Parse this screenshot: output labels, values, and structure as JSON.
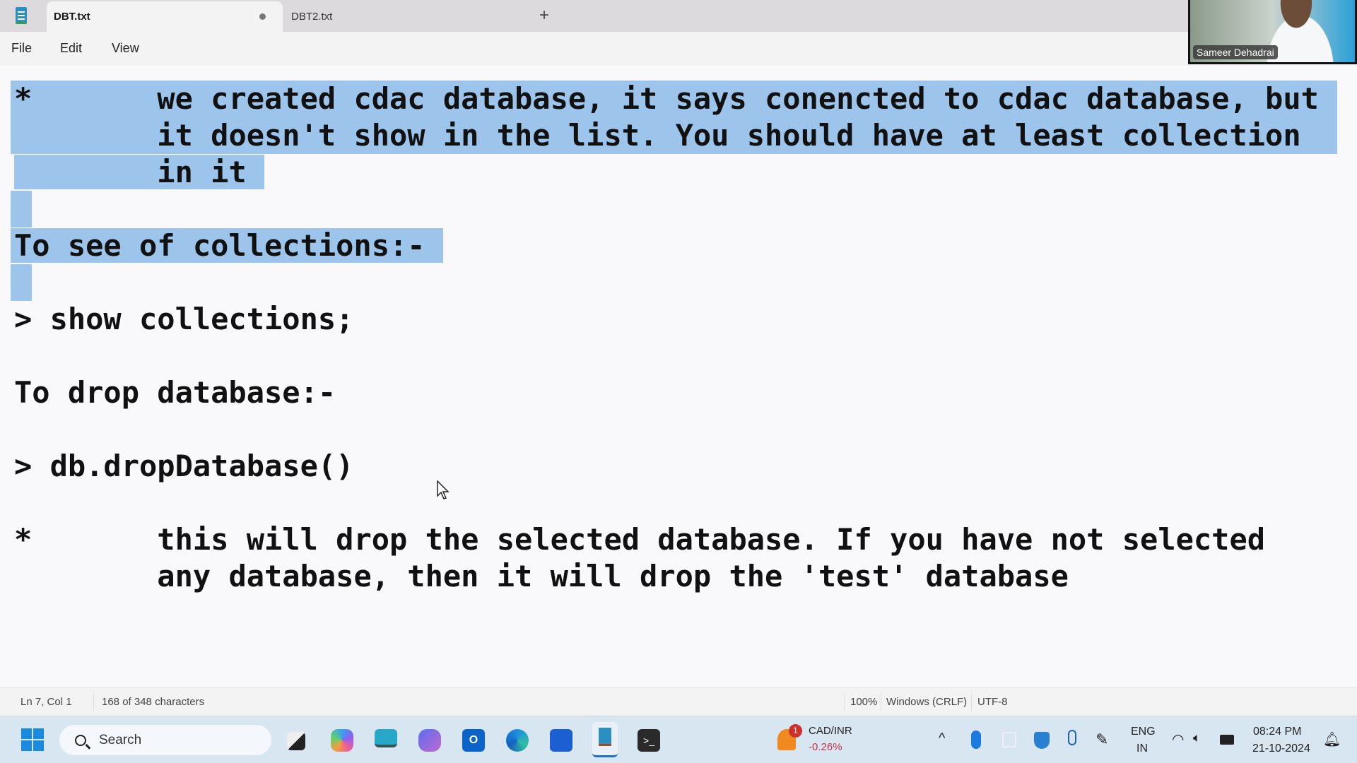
{
  "tabs": [
    {
      "label": "DBT.txt",
      "active": true,
      "unsaved": true
    },
    {
      "label": "DBT2.txt",
      "active": false
    }
  ],
  "new_tab": "+",
  "menu": [
    "File",
    "Edit",
    "View"
  ],
  "video": {
    "participant": "Sameer Dehadrai"
  },
  "editor": {
    "lines": [
      "*\twe created cdac database, it says conencted to cdac database, but",
      "\tit doesn't show in the list. You should have at least collection",
      "\tin it ",
      "",
      "To see of collections:- ",
      "",
      "> show collections;",
      "",
      "To drop database:-",
      "",
      "> db.dropDatabase()",
      "",
      "*\tthis will drop the selected database. If you have not selected",
      "\tany database, then it will drop the 'test' database"
    ],
    "selection_color": "#9dc5ec"
  },
  "status": {
    "position": "Ln 7, Col 1",
    "chars": "168 of 348 characters",
    "zoom": "100%",
    "line_ending": "Windows (CRLF)",
    "encoding": "UTF-8"
  },
  "taskbar": {
    "search": "Search",
    "apps": [
      "start-icon",
      "task-view-icon",
      "copilot-icon",
      "desktop-icon",
      "m365-icon",
      "outlook-icon",
      "edge-icon",
      "whiteboard-icon",
      "notepad-icon",
      "terminal-icon"
    ],
    "widget": {
      "title": "CAD/INR",
      "change": "-0.26%",
      "badge": "1",
      "change_color": "#c4314b"
    },
    "lang": "ENG",
    "region": "IN",
    "time": "08:24 PM",
    "date": "21-10-2024"
  }
}
